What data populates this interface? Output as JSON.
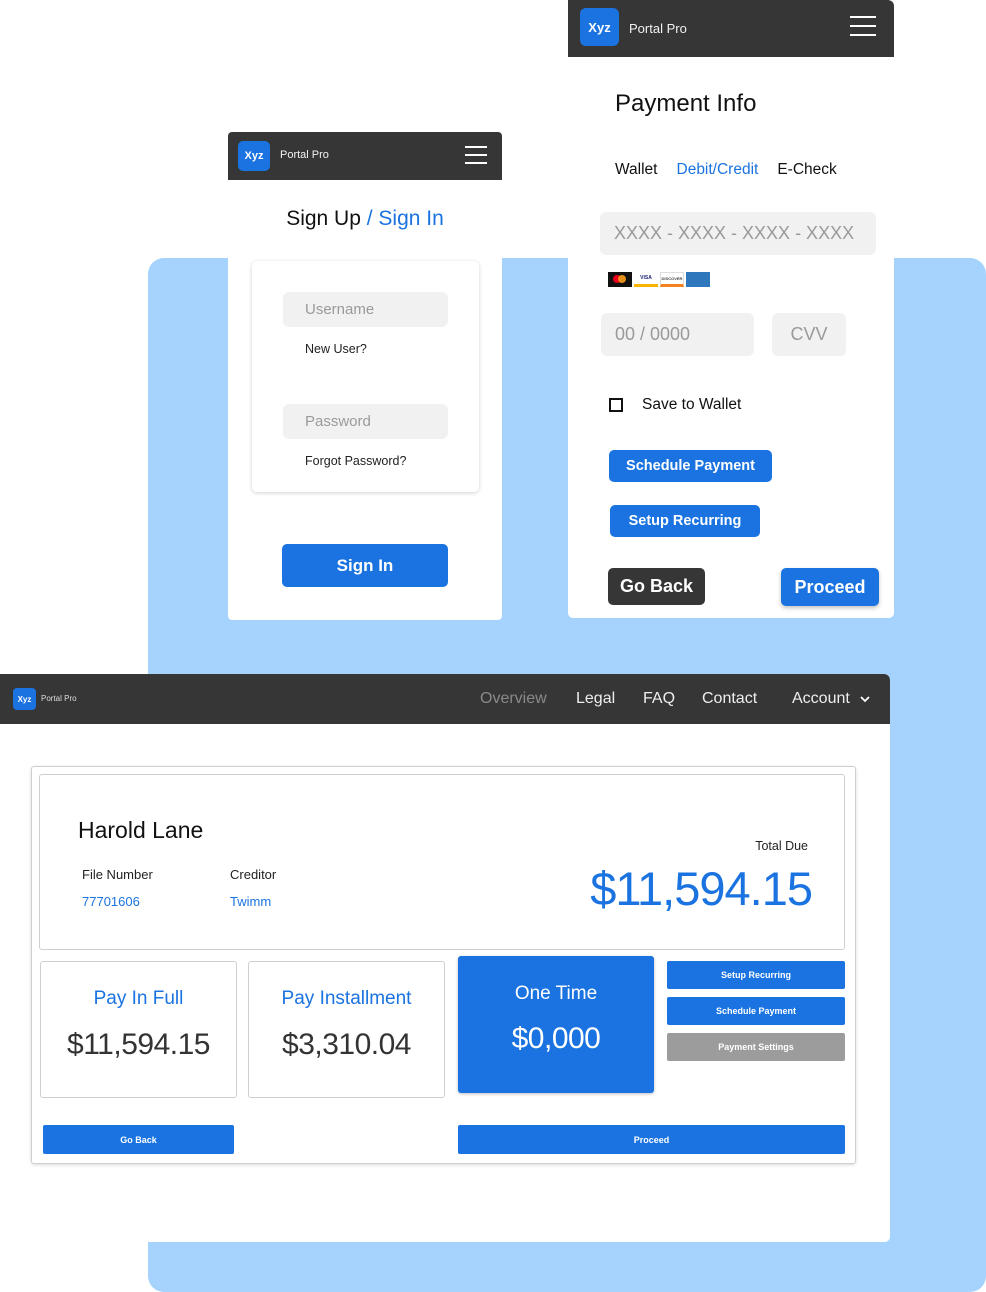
{
  "brand": {
    "logo_text": "Xyz",
    "app_name": "Portal Pro"
  },
  "colors": {
    "accent": "#1a73e0",
    "navbar": "#363636",
    "backdrop": "#a5d3fd",
    "muted_button": "#9c9c9c",
    "input_bg": "#f1f1f1"
  },
  "signin": {
    "title_prefix": "Sign Up",
    "title_accent": "/ Sign In",
    "username_placeholder": "Username",
    "new_user_link": "New User?",
    "password_placeholder": "Password",
    "forgot_link": "Forgot Password?",
    "submit_label": "Sign In"
  },
  "payment": {
    "title": "Payment Info",
    "tabs": [
      {
        "label": "Wallet",
        "active": false
      },
      {
        "label": "Debit/Credit",
        "active": true
      },
      {
        "label": "E-Check",
        "active": false
      }
    ],
    "card_number_placeholder": "XXXX - XXXX - XXXX - XXXX",
    "card_brands": [
      "mastercard",
      "VISA",
      "DISCOVER",
      "AMERICAN EXPRESS"
    ],
    "expiry_placeholder": "00 / 0000",
    "cvv_placeholder": "CVV",
    "save_to_wallet_label": "Save to Wallet",
    "save_to_wallet_checked": false,
    "schedule_label": "Schedule Payment",
    "recurring_label": "Setup Recurring",
    "go_back_label": "Go Back",
    "proceed_label": "Proceed"
  },
  "dashboard": {
    "nav": {
      "items": [
        {
          "label": "Overview",
          "active": true
        },
        {
          "label": "Legal",
          "active": false
        },
        {
          "label": "FAQ",
          "active": false
        },
        {
          "label": "Contact",
          "active": false
        },
        {
          "label": "Account",
          "active": false
        }
      ]
    },
    "customer": {
      "name": "Harold Lane",
      "file_number_label": "File Number",
      "file_number": "77701606",
      "creditor_label": "Creditor",
      "creditor": "Twimm",
      "total_due_label": "Total Due",
      "total_due": "$11,594.15"
    },
    "options": [
      {
        "title": "Pay In Full",
        "amount": "$11,594.15",
        "selected": false
      },
      {
        "title": "Pay Installment",
        "amount": "$3,310.04",
        "selected": false
      },
      {
        "title": "One Time",
        "amount": "$0,000",
        "selected": true
      }
    ],
    "side_buttons": {
      "recurring": "Setup Recurring",
      "schedule": "Schedule Payment",
      "settings": "Payment Settings"
    },
    "go_back_label": "Go Back",
    "proceed_label": "Proceed"
  }
}
